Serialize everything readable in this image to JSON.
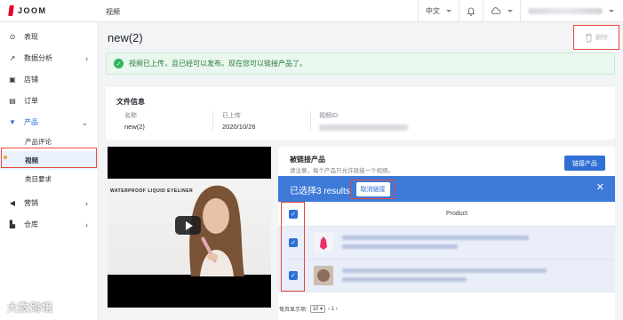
{
  "app": {
    "logo_text": "JOOM"
  },
  "header": {
    "breadcrumb": "视频",
    "language": "中文",
    "icons": [
      "bell-icon",
      "cloud-icon",
      "user-menu-icon"
    ]
  },
  "sidebar": {
    "items": [
      {
        "label": "表现",
        "icon": "performance-icon"
      },
      {
        "label": "数据分析",
        "icon": "analytics-icon"
      },
      {
        "label": "店铺",
        "icon": "store-icon"
      },
      {
        "label": "订单",
        "icon": "order-icon"
      },
      {
        "label": "产品",
        "icon": "shirt-icon"
      },
      {
        "label": "营销",
        "icon": "megaphone-icon"
      },
      {
        "label": "仓库",
        "icon": "warehouse-icon"
      }
    ],
    "sub_items": [
      "产品评论",
      "视频",
      "类目要求"
    ]
  },
  "main": {
    "title": "new(2)",
    "delete_label": "删除",
    "alert": "视频已上传，且已经可以发布。现在您可以链接产品了。",
    "info": {
      "title": "文件信息",
      "name_label": "名称",
      "name_value": "new(2)",
      "uploaded_label": "已上传",
      "uploaded_value": "2020/10/26",
      "video_id_label": "视频ID"
    },
    "video": {
      "caption": "WATERPROOF LIQUID EYELINER"
    },
    "linked": {
      "title": "被链接产品",
      "note": "请注意，每个产品只允许链接一个视频。",
      "link_button": "链接产品",
      "selected_text": "已选择3 results",
      "unlink_button": "取消链接",
      "column_product": "Product",
      "rows": [
        {
          "checked": true
        },
        {
          "checked": true
        }
      ],
      "header_checked": true,
      "page_size_label": "每页显示项:",
      "page_size": "10",
      "page_nav": "‹ 1 ›"
    }
  },
  "watermark": "大数跨境",
  "colors": {
    "accent": "#2f6fd6",
    "alert_green": "#2fb45f",
    "annotation_red": "#e6493b"
  }
}
